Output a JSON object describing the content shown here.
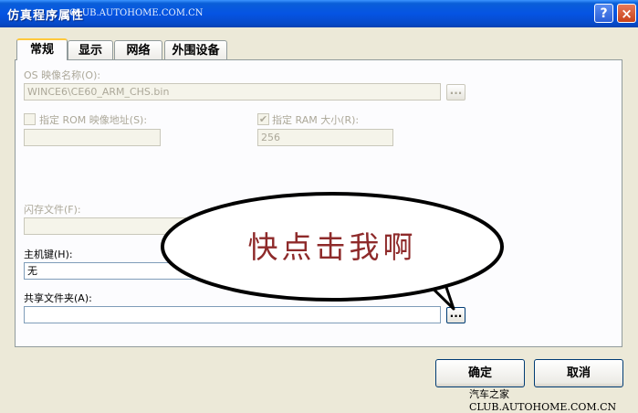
{
  "window": {
    "title": "仿真程序属性",
    "watermark_top": "CLUB.AUTOHOME.COM.CN",
    "help_label": "?",
    "close_label": "×"
  },
  "tabs": [
    {
      "label": "常规",
      "active": true
    },
    {
      "label": "显示",
      "active": false
    },
    {
      "label": "网络",
      "active": false
    },
    {
      "label": "外围设备",
      "active": false
    }
  ],
  "os_image": {
    "label": "OS 映像名称(O):",
    "value": "WINCE6\\CE60_ARM_CHS.bin",
    "browse_label": "..."
  },
  "rom_address": {
    "label": "指定 ROM 映像地址(S):",
    "checked": false,
    "value": ""
  },
  "ram_size": {
    "label": "指定 RAM 大小(R):",
    "checked": true,
    "value": "256"
  },
  "flash_file": {
    "label": "闪存文件(F):",
    "value": ""
  },
  "host_key": {
    "label": "主机键(H):",
    "value": "无"
  },
  "shared_folder": {
    "label": "共享文件夹(A):",
    "value": "",
    "browse_label": "..."
  },
  "callout": {
    "text": "快点击我啊"
  },
  "buttons": {
    "ok": "确定",
    "cancel": "取消"
  },
  "watermark_bottom": "汽车之家 CLUB.AUTOHOME.COM.CN"
}
